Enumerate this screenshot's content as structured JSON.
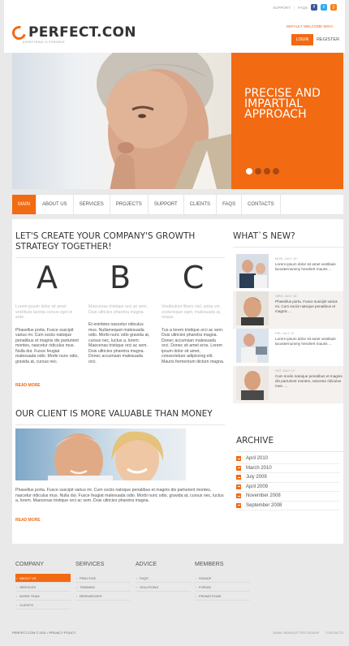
{
  "topbar": {
    "support": "SUPPORT",
    "sep": "|",
    "faqs": "FAQS"
  },
  "social": [
    {
      "icon": "facebook-icon",
      "glyph": "f"
    },
    {
      "icon": "twitter-icon",
      "glyph": "t"
    },
    {
      "icon": "rss-icon",
      "glyph": ")"
    }
  ],
  "logo": {
    "name": "PERFECT.CON",
    "tagline": "EVERYTHING IS POSSIBLE"
  },
  "welcome": "DEFAULT WELCOME MSG!",
  "auth": {
    "login": "LOGIN",
    "register": "REGISTER"
  },
  "hero": {
    "title": "PRECISE AND IMPARTIAL APPROACH",
    "slides": 4,
    "active_slide": 1
  },
  "nav": [
    "MAIN",
    "ABOUT US",
    "SERVICES",
    "PROJECTS",
    "SUPPORT",
    "CLIENTS",
    "FAQS",
    "CONTACTS"
  ],
  "main": {
    "heading": "LET'S CREATE YOUR COMPANY'S GROWTH STRATEGY TOGETHER!",
    "columns": [
      {
        "letter": "A",
        "lead": "Lorem ipsum dolor sit amet vestibule lacinia cursus eget in ante.",
        "text": "Phasellus porta. Fusce suscipit varius mi. Cum sociis natoque penatibus et magnis dis parturient montes, nascetur ridiculus mus. Nulla dui. Fusce feugiat malesuada odio. Morbi nunc odio, gravida at, cursus nec."
      },
      {
        "letter": "B",
        "lead": "Maecenas tristique orci ac sem. Duis ultricies pharetra magna.",
        "text": "Et eninbtes nascetur ridiculus mus. Nullamequet malesuada odio. Morbi nunc odio gravida at, cursus nec, luctus a, lorem. Maecenas tristique orci ac sem. Duis ultricies pharetra magna. Donec accumsan malesuada orci."
      },
      {
        "letter": "C",
        "lead": "Vestibulum libero nisl, porta vel, scelerisque eget, malesuada at, neque.",
        "text": "Tus a lorem tristique orci ac sem. Duis ultricies pharetra magna. Donec accumsan malesuada orci. Donec sit amet eros. Lorem ipsum dolor sit amet, consectetuer adipiscing elit. Mauris fermentum dictum magna."
      }
    ],
    "read_more": "READ MORE",
    "client_heading": "OUR CLIENT IS MORE VALUABLE THAN MONEY",
    "client_text": "Phasellus porta. Fusce suscipit varius mi. Cum sociis natoque penatibus et magnis dis parturient montes, nascetur ridiculus mus. Nulla dui. Fusce feugiat malesuada odio. Morbi nunc odio, gravida at, cursus nec, luctus a, lorem. Maecenas tristique orci ac sem. Duis ultricies pharetra magna."
  },
  "news": {
    "heading": "WHAT`S NEW?",
    "items": [
      {
        "date": "MON, JULY 19",
        "text": "Lorem ipsum dolor sit amet vestibule lacusternummy hendrert mauris ..."
      },
      {
        "date": "WED, JULY 18",
        "text": "Phasellus porta. Fusce suscipit varius mi. Cum sociis natoque penatibus et magnis ..."
      },
      {
        "date": "FRI, JULY 17",
        "text": "Lorem ipsum dolor sit amet vestibule lacusternummy hendrert mauris ..."
      },
      {
        "date": "SAT, JULY 17",
        "text": "Cum sociis natoque penatibus et magnis dis parturient montes, nascetur ridiculus mus. ..."
      }
    ]
  },
  "archive": {
    "heading": "ARCHIVE",
    "items": [
      "April 2010",
      "March 2010",
      "July 2009",
      "April 2009",
      "November 2008",
      "September 2008"
    ]
  },
  "footer": {
    "columns": [
      {
        "title": "COMPANY",
        "links": [
          "ABOUT US",
          "SERVICES",
          "WORK TEAM",
          "CLIENTS"
        ]
      },
      {
        "title": "SERVICES",
        "links": [
          "PRACTICE",
          "TRAINING",
          "RESEARCHES"
        ]
      },
      {
        "title": "ADVICE",
        "links": [
          "FAQS",
          "SOLUTIONS"
        ]
      },
      {
        "title": "MEMBERS",
        "links": [
          "SIGNUP",
          "FORUM",
          "PROMOTIONS"
        ]
      }
    ],
    "copyright": "PERFECT.CON © 2011 • PRIVACY POLICY",
    "newsletter": "EMAIL NEWSLETTER SIGNUP",
    "contacts": "CONTACTS"
  },
  "colors": {
    "accent": "#f26a12",
    "text": "#555555",
    "heading": "#333333",
    "background": "#e9e9e9"
  }
}
